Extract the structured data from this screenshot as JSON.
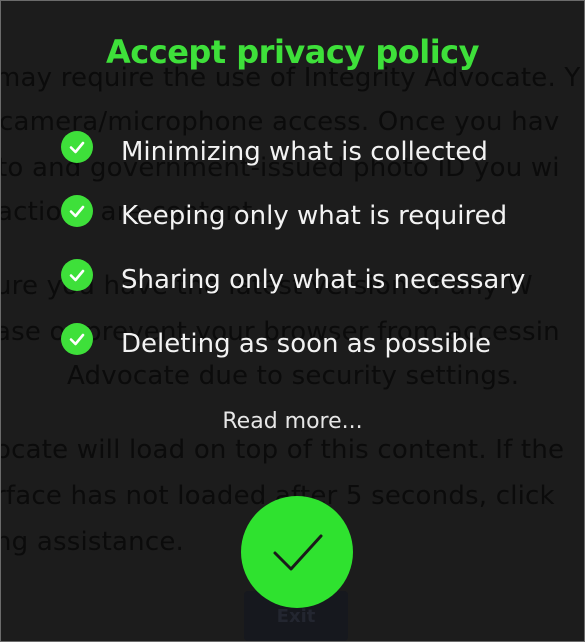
{
  "background": {
    "lines": [
      "may require the use of Integrity Advocate. Y",
      "camera/microphone access. Once you hav",
      "to and government-issued photo ID you wi",
      "actions are content.",
      "ure you have the latest version of any W",
      "ase or prevent your browser from accessin",
      "Advocate due to security settings.",
      "ocate will load on top of this content. If the",
      "rface has not loaded after 5 seconds, click",
      "ng assistance."
    ],
    "exit_label": "Exit"
  },
  "modal": {
    "title": "Accept privacy policy",
    "items": [
      {
        "label": "Minimizing what is collected"
      },
      {
        "label": "Keeping only what is required"
      },
      {
        "label": "Sharing only what is necessary"
      },
      {
        "label": "Deleting as soon as possible"
      }
    ],
    "read_more": "Read more..."
  },
  "colors": {
    "accent_green": "#3ee03a",
    "backdrop": "#1c1c1c"
  }
}
